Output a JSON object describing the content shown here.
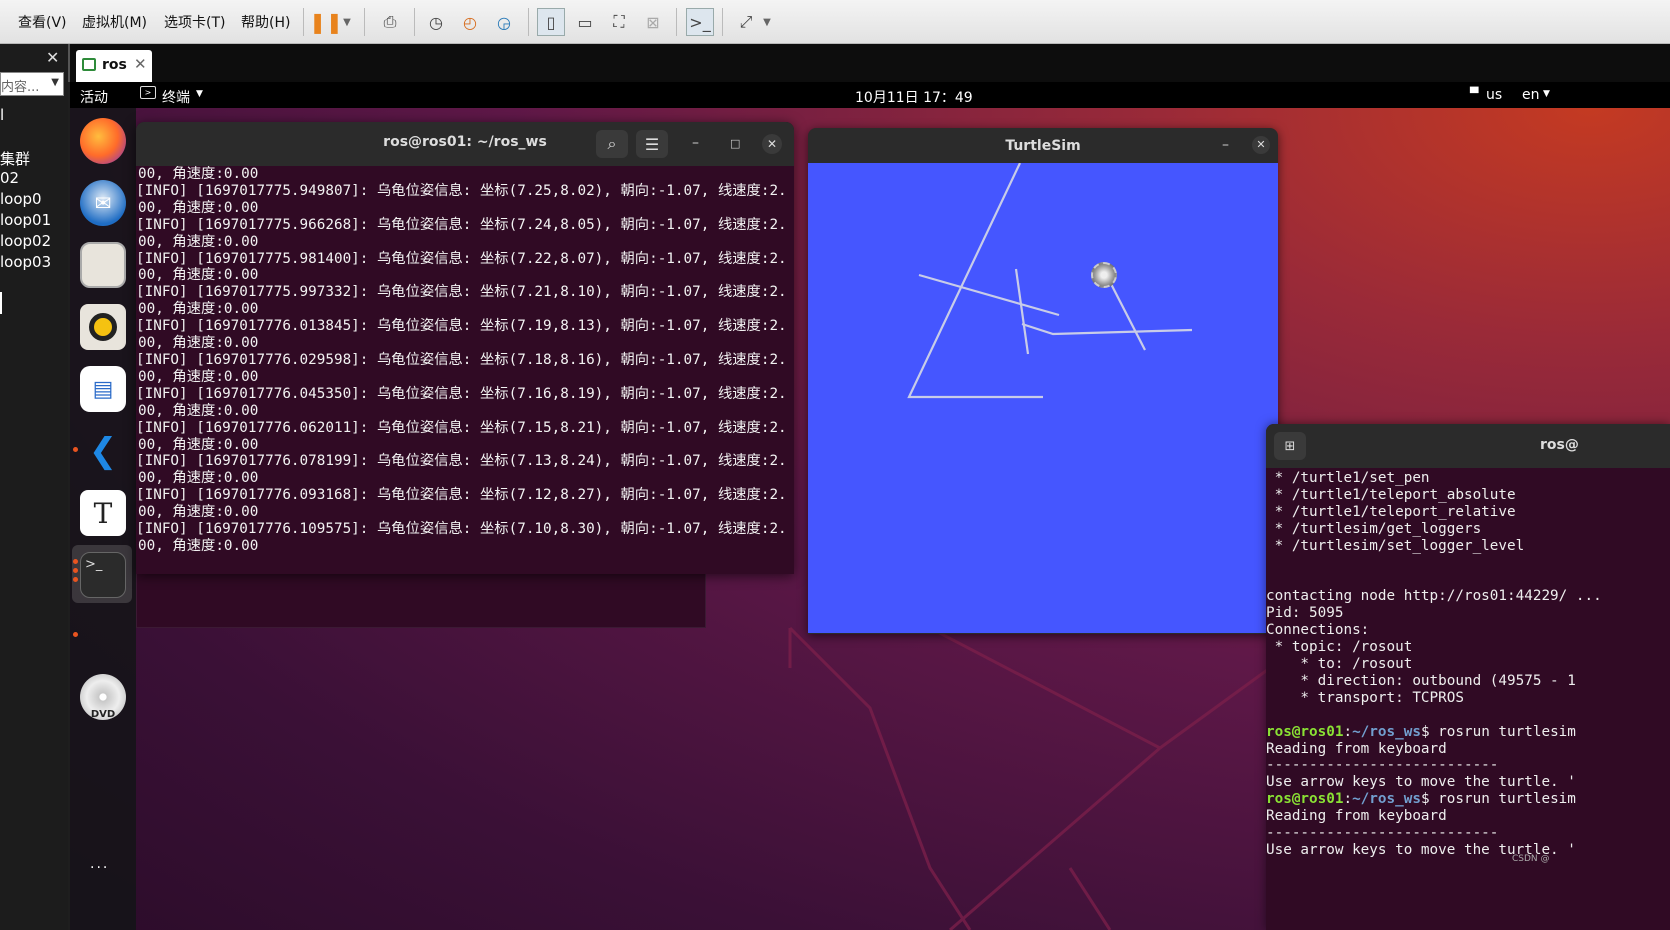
{
  "vm_menu": [
    "查看(V)",
    "虚拟机(M)",
    "选项卡(T)",
    "帮助(H)"
  ],
  "vm_library": {
    "search_placeholder": "内容...",
    "items": [
      "l",
      "集群",
      "02",
      "loop0",
      "loop01",
      "loop02",
      "loop03"
    ]
  },
  "vm_tab": {
    "label": "ros"
  },
  "ubuntu": {
    "activities": "活动",
    "app_menu": "终端",
    "clock": "10月11日 17：49",
    "kbd_indicator": "us",
    "lang": "en"
  },
  "terminal1": {
    "title": "ros@ros01: ~/ros_ws",
    "lines": [
      "00, 角速度:0.00",
      "[INFO] [1697017775.949807]: 乌龟位姿信息: 坐标(7.25,8.02), 朝向:-1.07, 线速度:2.",
      "00, 角速度:0.00",
      "[INFO] [1697017775.966268]: 乌龟位姿信息: 坐标(7.24,8.05), 朝向:-1.07, 线速度:2.",
      "00, 角速度:0.00",
      "[INFO] [1697017775.981400]: 乌龟位姿信息: 坐标(7.22,8.07), 朝向:-1.07, 线速度:2.",
      "00, 角速度:0.00",
      "[INFO] [1697017775.997332]: 乌龟位姿信息: 坐标(7.21,8.10), 朝向:-1.07, 线速度:2.",
      "00, 角速度:0.00",
      "[INFO] [1697017776.013845]: 乌龟位姿信息: 坐标(7.19,8.13), 朝向:-1.07, 线速度:2.",
      "00, 角速度:0.00",
      "[INFO] [1697017776.029598]: 乌龟位姿信息: 坐标(7.18,8.16), 朝向:-1.07, 线速度:2.",
      "00, 角速度:0.00",
      "[INFO] [1697017776.045350]: 乌龟位姿信息: 坐标(7.16,8.19), 朝向:-1.07, 线速度:2.",
      "00, 角速度:0.00",
      "[INFO] [1697017776.062011]: 乌龟位姿信息: 坐标(7.15,8.21), 朝向:-1.07, 线速度:2.",
      "00, 角速度:0.00",
      "[INFO] [1697017776.078199]: 乌龟位姿信息: 坐标(7.13,8.24), 朝向:-1.07, 线速度:2.",
      "00, 角速度:0.00",
      "[INFO] [1697017776.093168]: 乌龟位姿信息: 坐标(7.12,8.27), 朝向:-1.07, 线速度:2.",
      "00, 角速度:0.00",
      "[INFO] [1697017776.109575]: 乌龟位姿信息: 坐标(7.10,8.30), 朝向:-1.07, 线速度:2.",
      "00, 角速度:0.00"
    ]
  },
  "turtlesim": {
    "title": "TurtleSim",
    "bg": "#4556ff"
  },
  "terminal2": {
    "title": "ros@",
    "lines": [
      " * /turtle1/set_pen",
      " * /turtle1/teleport_absolute",
      " * /turtle1/teleport_relative",
      " * /turtlesim/get_loggers",
      " * /turtlesim/set_logger_level",
      "",
      "",
      "contacting node http://ros01:44229/ ...",
      "Pid: 5095",
      "Connections:",
      " * topic: /rosout",
      "    * to: /rosout",
      "    * direction: outbound (49575 - 1",
      "    * transport: TCPROS",
      "",
      "",
      "Reading from keyboard",
      "---------------------------",
      "Use arrow keys to move the turtle. '",
      "",
      "Reading from keyboard",
      "---------------------------",
      "Use arrow keys to move the turtle. '"
    ],
    "prompt_user": "ros@ros01",
    "prompt_path": "~/ros_ws",
    "prompt_cmd": "$ rosrun turtlesim",
    "watermark": "CSDN @"
  },
  "colors": {
    "ubuntu_accent": "#e95420",
    "terminal_bg": "#300a24"
  }
}
